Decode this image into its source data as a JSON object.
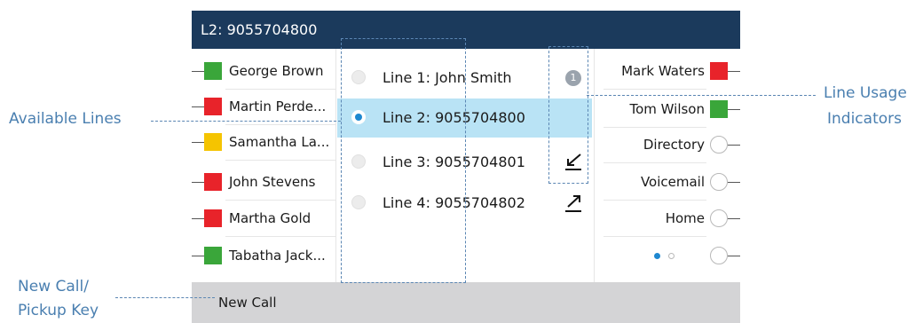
{
  "header": {
    "title": "L2: 9055704800"
  },
  "left_keys": [
    {
      "name": "George Brown",
      "status_color": "#3aa63a"
    },
    {
      "name": "Martin Perde...",
      "status_color": "#e8232a"
    },
    {
      "name": "Samantha La...",
      "status_color": "#f5c400"
    },
    {
      "name": "John Stevens",
      "status_color": "#e8232a"
    },
    {
      "name": "Martha Gold",
      "status_color": "#e8232a"
    },
    {
      "name": "Tabatha Jack...",
      "status_color": "#3aa63a"
    }
  ],
  "lines": [
    {
      "label": "Line 1: John Smith",
      "selected": false
    },
    {
      "label": "Line 2: 9055704800",
      "selected": true
    },
    {
      "label": "Line 3: 9055704801",
      "selected": false
    },
    {
      "label": "Line 4: 9055704802",
      "selected": false
    }
  ],
  "usage_indicators": {
    "badge_count": "1",
    "line3_icon": "incoming-call-arrow-icon",
    "line4_icon": "outgoing-call-arrow-icon"
  },
  "right_keys": [
    {
      "name": "Mark Waters",
      "status_color": "#e8232a"
    },
    {
      "name": "Tom Wilson",
      "status_color": "#3aa63a"
    },
    {
      "name": "Directory"
    },
    {
      "name": "Voicemail"
    },
    {
      "name": "Home"
    }
  ],
  "page_dots": {
    "active_color": "#1e88d0",
    "inactive_color": "#b8b8b8",
    "count": 2,
    "active_index": 0
  },
  "footer": {
    "softkey": "New Call"
  },
  "callouts": {
    "available_lines": "Available Lines",
    "line_usage_1": "Line Usage",
    "line_usage_2": "Indicators",
    "new_call_1": "New Call/",
    "new_call_2": "Pickup Key"
  },
  "colors": {
    "header_bg": "#1b3a5c",
    "selected_bg": "#b9e3f5",
    "footer_bg": "#d4d4d6",
    "callout": "#4a7fb0"
  }
}
